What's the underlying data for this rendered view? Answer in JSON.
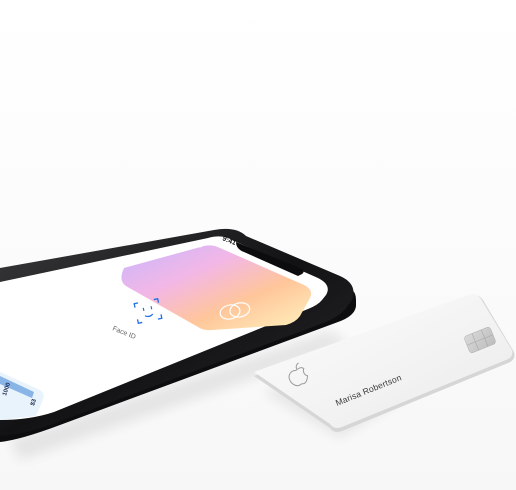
{
  "phone": {
    "status_time": "9:41",
    "face_id_label": "Face ID",
    "side_card_text_1": "1000",
    "side_card_text_2": "$3"
  },
  "physical_card": {
    "cardholder_name": "Marisa Robertson",
    "brand_icon": "apple-logo-icon"
  },
  "colors": {
    "phone_frame": "#1c1c1e",
    "card_surface": "#f5f5f5",
    "wallet_gradient": [
      "#c9b8ff",
      "#ffb3c7",
      "#ffd28a",
      "#fff6c2"
    ]
  }
}
